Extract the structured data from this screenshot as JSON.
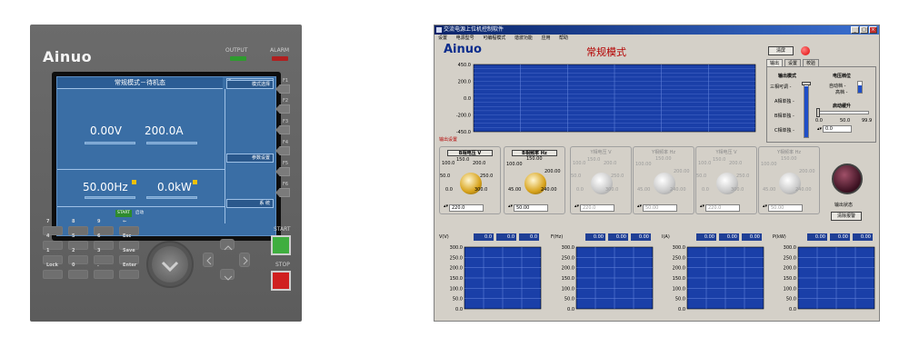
{
  "device": {
    "brand": "Ainuo",
    "indicators": [
      {
        "label": "OUTPUT",
        "color": "#2e9b2e"
      },
      {
        "label": "ALARM",
        "color": "#b02020"
      }
    ],
    "screen": {
      "title": "常规模式－待机态",
      "top_left_tag": "0",
      "voltage": "0.00V",
      "current": "200.0A",
      "frequency": "50.00Hz",
      "power": "0.0kW",
      "status": "START",
      "status_text": "启动",
      "softkeys": [
        "模式选择",
        "参数设置",
        "系 统"
      ]
    },
    "fkeys": [
      "F1",
      "F2",
      "F3",
      "F4",
      "F5",
      "F6"
    ],
    "keypad": [
      [
        "7",
        "8",
        "9",
        "←"
      ],
      [
        "4",
        "5",
        "6",
        "Esc"
      ],
      [
        "1",
        "2",
        "3",
        "Save"
      ],
      [
        "Lock",
        "0",
        ".",
        "Enter"
      ]
    ],
    "start_label": "START",
    "stop_label": "STOP",
    "colors": {
      "start": "#3fae3f",
      "stop": "#d02020",
      "lcd": "#3a6ea5"
    }
  },
  "app": {
    "title": "交流电源上位机控制软件",
    "window_buttons": [
      "_",
      "□",
      "×"
    ],
    "menu": [
      "设置",
      "电源型号",
      "可编程模式",
      "谐波功能",
      "应用",
      "帮助"
    ],
    "logo": "Ainuo",
    "mode_title": "常规模式",
    "clear_button": "清屏",
    "output_settings_label": "输出设置",
    "tabs": [
      "输出",
      "设置",
      "校验"
    ],
    "tab_panel": {
      "output_mode_label": "输出模式",
      "output_modes": [
        "三相可调 -",
        "A相单独 -",
        "B相单独 -",
        "C相单独 -"
      ],
      "voltage_range_label": "电压档位",
      "voltage_ranges": [
        "自动档 -",
        "高档 -"
      ],
      "soft_start_label": "启动缓升",
      "soft_start_scale": [
        "0.0",
        "50.0",
        "99.9"
      ],
      "soft_start_value": "0.0"
    },
    "main_chart": {
      "y_ticks": [
        "450.0",
        "200.0",
        "0.0",
        "-200.0",
        "-450.0"
      ]
    },
    "channels": [
      {
        "label": "B相电压 V",
        "scale": [
          "100.0",
          "150.0",
          "200.0",
          "50.0",
          "250.0",
          "0.0",
          "300.0"
        ],
        "value": "220.0",
        "active": true,
        "color": "#d7a21a"
      },
      {
        "label": "B相频率 Hz",
        "scale": [
          "100.00",
          "150.00",
          "45.00",
          "200.00",
          "240.00"
        ],
        "value": "50.00",
        "active": true,
        "color": "#d7a21a"
      },
      {
        "label": "Y相电压 V",
        "scale": [
          "100.0",
          "150.0",
          "200.0",
          "50.0",
          "250.0",
          "0.0",
          "300.0"
        ],
        "value": "220.0",
        "active": false,
        "color": "#c8c8c8"
      },
      {
        "label": "Y相频率 Hz",
        "scale": [
          "100.00",
          "150.00",
          "45.00",
          "200.00",
          "240.00"
        ],
        "value": "50.00",
        "active": false,
        "color": "#c8c8c8"
      },
      {
        "label": "Y相电压 V",
        "scale": [
          "100.0",
          "150.0",
          "200.0",
          "50.0",
          "250.0",
          "0.0",
          "300.0"
        ],
        "value": "220.0",
        "active": false,
        "color": "#c8c8c8"
      },
      {
        "label": "Y相频率 Hz",
        "scale": [
          "100.00",
          "150.00",
          "45.00",
          "200.00",
          "240.00"
        ],
        "value": "50.00",
        "active": false,
        "color": "#c8c8c8"
      }
    ],
    "output_status_label": "输出状态",
    "alarm_button": "清除报警",
    "mini_charts": [
      {
        "label": "V(V)",
        "values": [
          "0.0",
          "0.0",
          "0.0"
        ]
      },
      {
        "label": "F(Hz)",
        "values": [
          "0.00",
          "0.00",
          "0.00"
        ]
      },
      {
        "label": "I(A)",
        "values": [
          "0.00",
          "0.00",
          "0.00"
        ]
      },
      {
        "label": "P(kW)",
        "values": [
          "0.00",
          "0.00",
          "0.00"
        ]
      }
    ],
    "mini_y_ticks": [
      "300.0",
      "250.0",
      "200.0",
      "150.0",
      "100.0",
      "50.0",
      "0.0"
    ],
    "colors": {
      "plot_bg": "#1a3fa8",
      "grid": "#6a8ae0",
      "accent_red": "#b40000"
    }
  }
}
